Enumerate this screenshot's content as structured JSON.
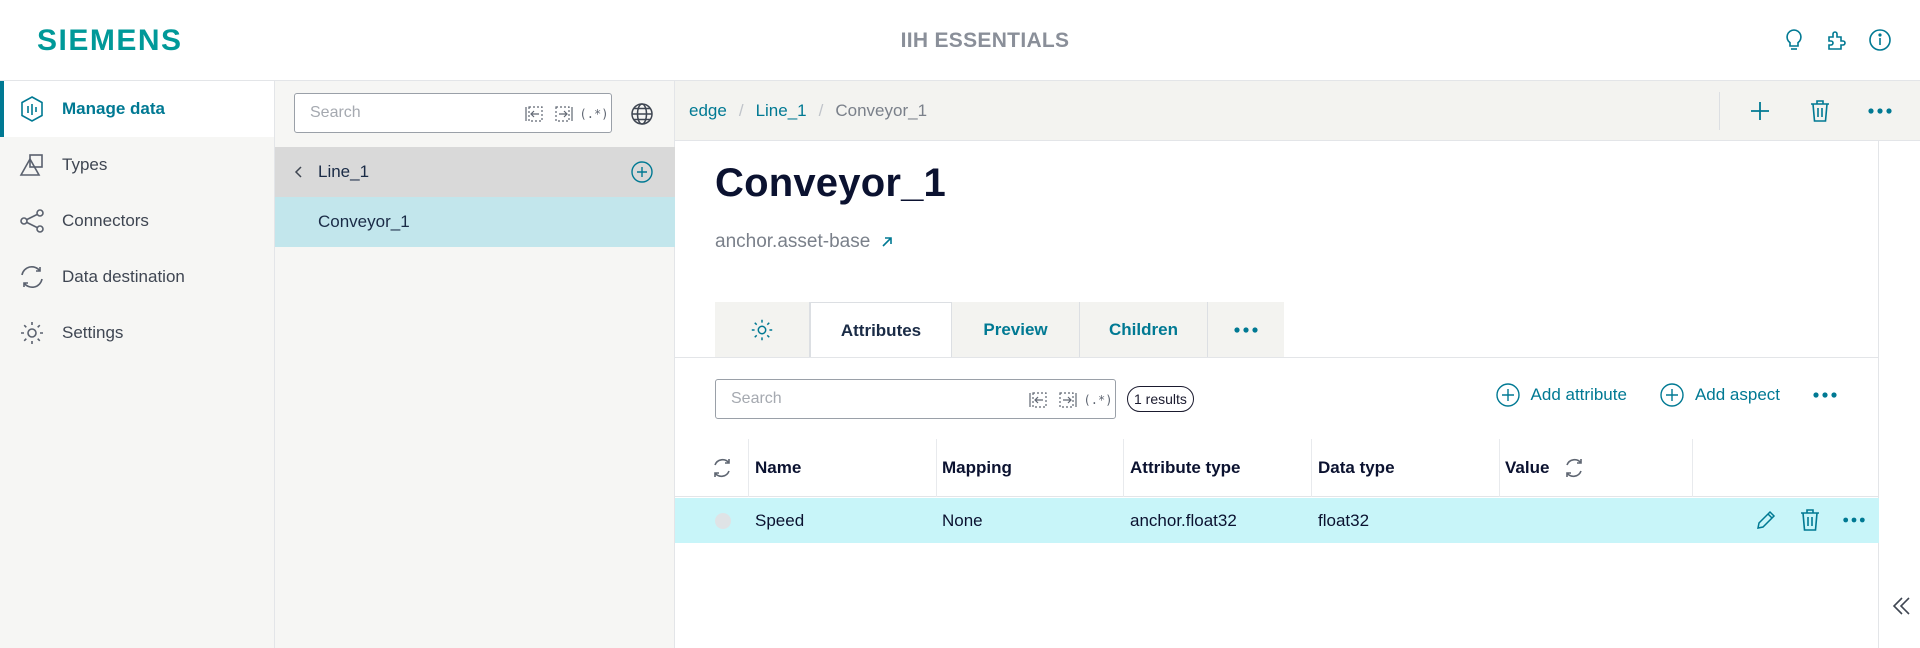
{
  "header": {
    "logo": "SIEMENS",
    "app_title": "IIH ESSENTIALS",
    "icons": [
      "lightbulb-icon",
      "puzzle-icon",
      "info-icon"
    ]
  },
  "nav": {
    "items": [
      {
        "label": "Manage data",
        "icon": "manage-data-icon",
        "active": true
      },
      {
        "label": "Types",
        "icon": "types-icon",
        "active": false
      },
      {
        "label": "Connectors",
        "icon": "share-icon",
        "active": false
      },
      {
        "label": "Data destination",
        "icon": "sync-icon",
        "active": false
      },
      {
        "label": "Settings",
        "icon": "gear-icon",
        "active": false
      }
    ]
  },
  "tree": {
    "search_placeholder": "Search",
    "search_options": [
      "match-start",
      "match-end",
      "(.*)"
    ],
    "parent": "Line_1",
    "child": "Conveyor_1"
  },
  "breadcrumb": {
    "items": [
      "edge",
      "Line_1",
      "Conveyor_1"
    ]
  },
  "asset": {
    "title": "Conveyor_1",
    "type_link": "anchor.asset-base"
  },
  "tabs": [
    {
      "label": "",
      "icon": "gear-icon"
    },
    {
      "label": "Attributes",
      "active": true
    },
    {
      "label": "Preview"
    },
    {
      "label": "Children"
    },
    {
      "label": "",
      "icon": "more-icon"
    }
  ],
  "attributes": {
    "search_placeholder": "Search",
    "search_options": [
      "match-start",
      "match-end",
      "(.*)"
    ],
    "result_count": "1 results",
    "add_attribute": "Add attribute",
    "add_aspect": "Add aspect",
    "columns": [
      "Name",
      "Mapping",
      "Attribute type",
      "Data type",
      "Value"
    ],
    "rows": [
      {
        "name": "Speed",
        "mapping": "None",
        "attribute_type": "anchor.float32",
        "data_type": "float32",
        "value": ""
      }
    ]
  },
  "colors": {
    "brand": "#009999",
    "accent": "#007993",
    "selected_row": "#c8f5f9",
    "tree_selected": "#c2e6ec"
  }
}
